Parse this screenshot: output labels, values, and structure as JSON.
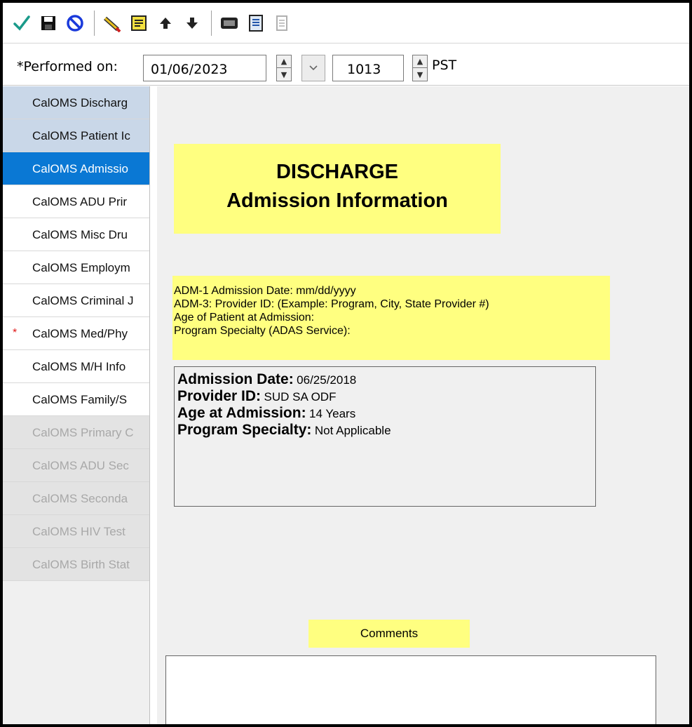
{
  "toolbar": {
    "buttons": [
      {
        "icon": "checkmark-icon",
        "color": "#1a9a8a"
      },
      {
        "icon": "save-icon"
      },
      {
        "icon": "cancel-icon",
        "color": "#1a3adb"
      },
      {
        "icon": "pencil-icon"
      },
      {
        "icon": "notes-icon"
      },
      {
        "icon": "arrow-up-icon"
      },
      {
        "icon": "arrow-down-icon"
      },
      {
        "icon": "calculator-icon"
      },
      {
        "icon": "form-icon"
      },
      {
        "icon": "document-icon"
      }
    ]
  },
  "performed": {
    "label": "*Performed on:",
    "date": "01/06/2023",
    "time": "1013",
    "timezone": "PST"
  },
  "nav": {
    "items": [
      {
        "label": "CalOMS Discharg",
        "state": "done"
      },
      {
        "label": "CalOMS Patient Ic",
        "state": "done"
      },
      {
        "label": "CalOMS Admissio",
        "state": "selected"
      },
      {
        "label": "CalOMS ADU Prir",
        "state": "normal"
      },
      {
        "label": "CalOMS Misc Dru",
        "state": "normal"
      },
      {
        "label": "CalOMS Employm",
        "state": "normal"
      },
      {
        "label": "CalOMS Criminal J",
        "state": "normal"
      },
      {
        "label": "CalOMS Med/Phy",
        "state": "required"
      },
      {
        "label": "CalOMS M/H Info",
        "state": "normal"
      },
      {
        "label": "CalOMS Family/S",
        "state": "normal"
      },
      {
        "label": "CalOMS Primary C",
        "state": "disabled"
      },
      {
        "label": "CalOMS ADU Sec",
        "state": "disabled"
      },
      {
        "label": "CalOMS Seconda",
        "state": "disabled"
      },
      {
        "label": "CalOMS HIV Test",
        "state": "disabled"
      },
      {
        "label": "CalOMS Birth Stat",
        "state": "disabled"
      }
    ],
    "required_mark": "*"
  },
  "form": {
    "title_line1": "DISCHARGE",
    "title_line2": "Admission Information",
    "info_lines": [
      "ADM-1  Admission Date: mm/dd/yyyy",
      "ADM-3: Provider ID: (Example: Program, City, State Provider #)",
      "Age of Patient at Admission:",
      "Program Specialty (ADAS Service):"
    ],
    "details": {
      "admission_date_label": "Admission Date:",
      "admission_date_value": "06/25/2018",
      "provider_id_label": "Provider ID:",
      "provider_id_value": "SUD SA ODF",
      "age_label": "Age at Admission:",
      "age_value": "14 Years",
      "specialty_label": "Program Specialty:",
      "specialty_value": "Not Applicable"
    },
    "comments_label": "Comments",
    "comments_value": ""
  },
  "colors": {
    "highlight_yellow": "#ffff80",
    "selected_blue": "#0a78d4",
    "done_blue": "#c9d7e8"
  }
}
